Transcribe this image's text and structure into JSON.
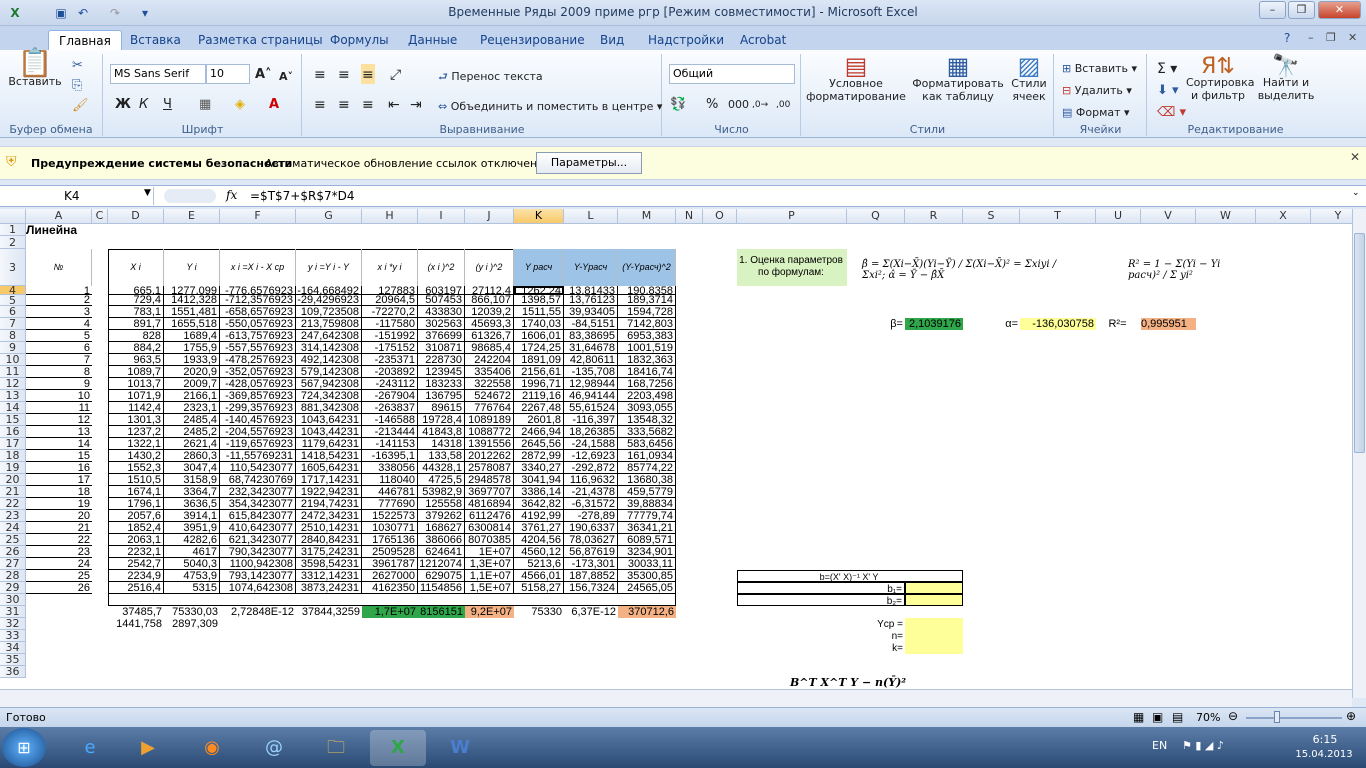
{
  "window": {
    "title": "Временные Ряды 2009 приме ргр  [Режим совместимости] - Microsoft Excel"
  },
  "tabs": [
    "Главная",
    "Вставка",
    "Разметка страницы",
    "Формулы",
    "Данные",
    "Рецензирование",
    "Вид",
    "Надстройки",
    "Acrobat"
  ],
  "ribbon": {
    "clipboard": {
      "label": "Буфер обмена",
      "paste": "Вставить"
    },
    "font": {
      "label": "Шрифт",
      "name": "MS Sans Serif",
      "size": "10"
    },
    "align": {
      "label": "Выравнивание",
      "wrap": "Перенос текста",
      "merge": "Объединить и поместить в центре"
    },
    "number": {
      "label": "Число",
      "format": "Общий"
    },
    "styles": {
      "label": "Стили",
      "cond": "Условное форматирование",
      "table": "Форматировать как таблицу",
      "cell": "Стили ячеек"
    },
    "cells": {
      "label": "Ячейки",
      "insert": "Вставить",
      "delete": "Удалить",
      "format": "Формат"
    },
    "edit": {
      "label": "Редактирование",
      "sort": "Сортировка и фильтр",
      "find": "Найти и выделить"
    }
  },
  "security": {
    "title": "Предупреждение системы безопасности",
    "text": "Автоматическое обновление ссылок отключено",
    "button": "Параметры..."
  },
  "formula": {
    "cell": "K4",
    "fx": "fx",
    "value": "=$T$7+$R$7*D4"
  },
  "columns": [
    "A",
    "C",
    "D",
    "E",
    "F",
    "G",
    "H",
    "I",
    "J",
    "K",
    "L",
    "M",
    "N",
    "O",
    "P",
    "Q",
    "R",
    "S",
    "T",
    "U",
    "V",
    "W",
    "X",
    "Y"
  ],
  "row_numbers": [
    "1",
    "2",
    "3",
    "4",
    "5",
    "6",
    "7",
    "8",
    "9",
    "10",
    "11",
    "12",
    "13",
    "14",
    "15",
    "16",
    "17",
    "18",
    "19",
    "20",
    "21",
    "22",
    "23",
    "24",
    "25",
    "26",
    "27",
    "28",
    "29",
    "30",
    "31",
    "32",
    "33",
    "34",
    "35",
    "36"
  ],
  "headers": {
    "a1": "Линейна",
    "num": "№",
    "X": "X i",
    "Y": "Y i",
    "x": "x i =X i - X ср",
    "y": "y i =Y i - Y",
    "xy": "x i *y i",
    "x2": "(x i )^2",
    "y2": "(y i )^2",
    "yr": "Y расч",
    "yyr": "Y-Yрасч",
    "yyr2": "(Y-Yрасч)^2"
  },
  "table": [
    [
      "1",
      "665,1",
      "1277,099",
      "-776,6576923",
      "-164,668492",
      "127883",
      "603197",
      "27112,4",
      "1262,24",
      "13,81433",
      "190,8358"
    ],
    [
      "2",
      "729,4",
      "1412,328",
      "-712,3576923",
      "-29,4296923",
      "20964,5",
      "507453",
      "866,107",
      "1398,57",
      "13,76123",
      "189,3714"
    ],
    [
      "3",
      "783,1",
      "1551,481",
      "-658,6576923",
      "109,723508",
      "-72270,2",
      "433830",
      "12039,2",
      "1511,55",
      "39,93405",
      "1594,728"
    ],
    [
      "4",
      "891,7",
      "1655,518",
      "-550,0576923",
      "213,759808",
      "-117580",
      "302563",
      "45693,3",
      "1740,03",
      "-84,5151",
      "7142,803"
    ],
    [
      "5",
      "828",
      "1689,4",
      "-613,7576923",
      "247,642308",
      "-151992",
      "376699",
      "61326,7",
      "1606,01",
      "83,38695",
      "6953,383"
    ],
    [
      "6",
      "884,2",
      "1755,9",
      "-557,5576923",
      "314,142308",
      "-175152",
      "310871",
      "98685,4",
      "1724,25",
      "31,64678",
      "1001,519"
    ],
    [
      "7",
      "963,5",
      "1933,9",
      "-478,2576923",
      "492,142308",
      "-235371",
      "228730",
      "242204",
      "1891,09",
      "42,80611",
      "1832,363"
    ],
    [
      "8",
      "1089,7",
      "2020,9",
      "-352,0576923",
      "579,142308",
      "-203892",
      "123945",
      "335406",
      "2156,61",
      "-135,708",
      "18416,74"
    ],
    [
      "9",
      "1013,7",
      "2009,7",
      "-428,0576923",
      "567,942308",
      "-243112",
      "183233",
      "322558",
      "1996,71",
      "12,98944",
      "168,7256"
    ],
    [
      "10",
      "1071,9",
      "2166,1",
      "-369,8576923",
      "724,342308",
      "-267904",
      "136795",
      "524672",
      "2119,16",
      "46,94144",
      "2203,498"
    ],
    [
      "11",
      "1142,4",
      "2323,1",
      "-299,3576923",
      "881,342308",
      "-263837",
      "89615",
      "776764",
      "2267,48",
      "55,61524",
      "3093,055"
    ],
    [
      "12",
      "1301,3",
      "2485,4",
      "-140,4576923",
      "1043,64231",
      "-146588",
      "19728,4",
      "1089189",
      "2601,8",
      "-116,397",
      "13548,32"
    ],
    [
      "13",
      "1237,2",
      "2485,2",
      "-204,5576923",
      "1043,44231",
      "-213444",
      "41843,8",
      "1088772",
      "2466,94",
      "18,26385",
      "333,5682"
    ],
    [
      "14",
      "1322,1",
      "2621,4",
      "-119,6576923",
      "1179,64231",
      "-141153",
      "14318",
      "1391556",
      "2645,56",
      "-24,1588",
      "583,6456"
    ],
    [
      "15",
      "1430,2",
      "2860,3",
      "-11,55769231",
      "1418,54231",
      "-16395,1",
      "133,58",
      "2012262",
      "2872,99",
      "-12,6923",
      "161,0934"
    ],
    [
      "16",
      "1552,3",
      "3047,4",
      "110,5423077",
      "1605,64231",
      "338056",
      "44328,1",
      "2578087",
      "3340,27",
      "-292,872",
      "85774,22"
    ],
    [
      "17",
      "1510,5",
      "3158,9",
      "68,74230769",
      "1717,14231",
      "118040",
      "4725,5",
      "2948578",
      "3041,94",
      "116,9632",
      "13680,38"
    ],
    [
      "18",
      "1674,1",
      "3364,7",
      "232,3423077",
      "1922,94231",
      "446781",
      "53982,9",
      "3697707",
      "3386,14",
      "-21,4378",
      "459,5779"
    ],
    [
      "19",
      "1796,1",
      "3636,5",
      "354,3423077",
      "2194,74231",
      "777690",
      "125558",
      "4816894",
      "3642,82",
      "-6,31572",
      "39,88834"
    ],
    [
      "20",
      "2057,6",
      "3914,1",
      "615,8423077",
      "2472,34231",
      "1522573",
      "379262",
      "6112476",
      "4192,99",
      "-278,89",
      "77779,74"
    ],
    [
      "21",
      "1852,4",
      "3951,9",
      "410,6423077",
      "2510,14231",
      "1030771",
      "168627",
      "6300814",
      "3761,27",
      "190,6337",
      "36341,21"
    ],
    [
      "22",
      "2063,1",
      "4282,6",
      "621,3423077",
      "2840,84231",
      "1765136",
      "386066",
      "8070385",
      "4204,56",
      "78,03627",
      "6089,571"
    ],
    [
      "23",
      "2232,1",
      "4617",
      "790,3423077",
      "3175,24231",
      "2509528",
      "624641",
      "1E+07",
      "4560,12",
      "56,87619",
      "3234,901"
    ],
    [
      "24",
      "2542,7",
      "5040,3",
      "1100,942308",
      "3598,54231",
      "3961787",
      "1212074",
      "1,3E+07",
      "5213,6",
      "-173,301",
      "30033,11"
    ],
    [
      "25",
      "2234,9",
      "4753,9",
      "793,1423077",
      "3312,14231",
      "2627000",
      "629075",
      "1,1E+07",
      "4566,01",
      "187,8852",
      "35300,85"
    ],
    [
      "26",
      "2516,4",
      "5315",
      "1074,642308",
      "3873,24231",
      "4162350",
      "1154856",
      "1,5E+07",
      "5158,27",
      "156,7324",
      "24565,05"
    ]
  ],
  "totals": {
    "d31": "37485,7",
    "e31": "75330,03",
    "f31": "2,72848E-12",
    "g31": "37844,3259",
    "h31": "1,7E+07",
    "i31": "8156151",
    "j31": "9,2E+07",
    "k31": "75330",
    "l31": "6,37E-12",
    "m31": "370712,6",
    "d32": "1441,758",
    "e32": "2897,309"
  },
  "side": {
    "p3": "1. Оценка параметров по формулам:",
    "beta_label": "β=",
    "beta": "2,1039176",
    "alpha_label": "α=",
    "alpha": "-136,030758",
    "r2_label": "R²=",
    "r2": "0,995951",
    "b_title": "b=(X' X)⁻¹ X' Y",
    "b1": "b₁=",
    "b2": "b₂=",
    "ycp": "Ycp =",
    "n": "n=",
    "k": "k="
  },
  "formulas": {
    "beta": "β̂ = Σ(Xi−X̄)(Yi−Ȳ) / Σ(Xi−X̄)² = Σxiyi / Σxi²;   α̂ = Ȳ − β̂X̄",
    "r2": "R² = 1 − Σ(Yi − Yi расч)² / Σ yi²",
    "bottom": "B^T X^T Y − n(Ȳ)²"
  },
  "sheetbar": {
    "a": "",
    "b": ""
  },
  "status": {
    "ready": "Готово",
    "zoom": "70%"
  },
  "taskbar": {
    "lang": "EN",
    "time": "6:15",
    "date": "15.04.2013"
  },
  "colors": {
    "green": "#2fa64a",
    "yellow": "#ffff99",
    "orange": "#f4b183",
    "blue": "#9dc3e6",
    "lightgreen": "#d9f2c2"
  }
}
